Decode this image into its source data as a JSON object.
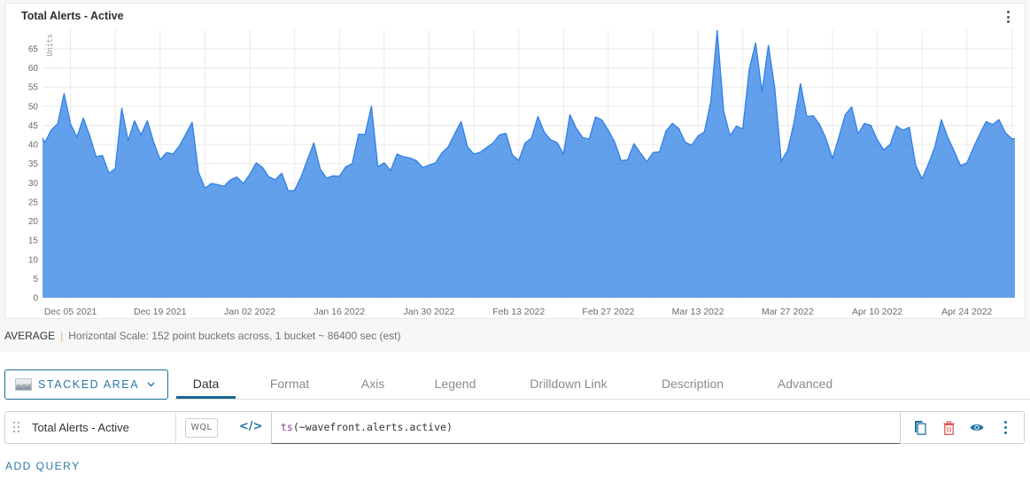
{
  "panel": {
    "title": "Total Alerts - Active",
    "menu_icon": "kebab-vertical-icon"
  },
  "chart_data": {
    "type": "area",
    "stacked": true,
    "title": "Total Alerts - Active",
    "xlabel": "",
    "ylabel": "Units",
    "ylim": [
      0,
      70
    ],
    "yticks": [
      0,
      5,
      10,
      15,
      20,
      25,
      30,
      35,
      40,
      45,
      50,
      55,
      60,
      65
    ],
    "x_start": "2021-12-01",
    "bucket": "1 day (86400 sec)",
    "xlim_days": [
      -0.37,
      151.5
    ],
    "x_grid_step_days": 7,
    "xticks": [
      {
        "date": "2021-12-05",
        "label": "Dec 05 2021"
      },
      {
        "date": "2021-12-19",
        "label": "Dec 19 2021"
      },
      {
        "date": "2022-01-02",
        "label": "Jan 02 2022"
      },
      {
        "date": "2022-01-16",
        "label": "Jan 16 2022"
      },
      {
        "date": "2022-01-30",
        "label": "Jan 30 2022"
      },
      {
        "date": "2022-02-13",
        "label": "Feb 13 2022"
      },
      {
        "date": "2022-02-27",
        "label": "Feb 27 2022"
      },
      {
        "date": "2022-03-13",
        "label": "Mar 13 2022"
      },
      {
        "date": "2022-03-27",
        "label": "Mar 27 2022"
      },
      {
        "date": "2022-04-10",
        "label": "Apr 10 2022"
      },
      {
        "date": "2022-04-24",
        "label": "Apr 24 2022"
      }
    ],
    "grid": true,
    "legend": "none",
    "series": [
      {
        "name": "Total Alerts - Active",
        "color": "#2f80e6",
        "left_edge_value": 41.7,
        "values": [
          40.5,
          43.8,
          45.4,
          53.3,
          45.4,
          41.9,
          46.9,
          42.3,
          36.8,
          37.1,
          32.5,
          33.7,
          49.5,
          41.0,
          46.2,
          42.5,
          46.2,
          40.6,
          36.0,
          37.9,
          37.5,
          39.6,
          42.7,
          45.8,
          32.7,
          28.6,
          29.8,
          29.5,
          29.1,
          30.8,
          31.5,
          29.8,
          32.2,
          35.2,
          34.0,
          31.5,
          30.8,
          32.5,
          27.9,
          28.0,
          31.5,
          36.0,
          40.4,
          33.6,
          31.2,
          31.8,
          31.7,
          34.2,
          35.0,
          42.7,
          42.6,
          50.0,
          34.2,
          35.2,
          33.2,
          37.5,
          36.8,
          36.5,
          35.8,
          34.0,
          34.6,
          35.2,
          37.8,
          39.4,
          42.8,
          46.0,
          39.4,
          37.5,
          38.0,
          39.2,
          40.4,
          42.5,
          42.9,
          37.3,
          35.8,
          40.4,
          41.7,
          47.3,
          43.2,
          41.2,
          40.5,
          37.5,
          47.8,
          44.2,
          41.8,
          41.4,
          47.2,
          46.4,
          43.7,
          40.6,
          35.8,
          36.0,
          40.2,
          37.8,
          35.5,
          37.9,
          38.1,
          43.5,
          45.5,
          44.2,
          40.6,
          39.8,
          42.2,
          43.3,
          51.2,
          69.8,
          48.8,
          42.3,
          44.8,
          44.1,
          59.6,
          66.5,
          53.8,
          65.9,
          54.6,
          35.6,
          38.5,
          45.8,
          55.9,
          47.3,
          47.5,
          45.2,
          41.5,
          36.3,
          41.9,
          47.8,
          49.8,
          42.8,
          45.5,
          45.0,
          41.2,
          38.6,
          40.0,
          44.8,
          43.7,
          44.5,
          34.6,
          31.0,
          35.0,
          39.4,
          46.5,
          41.9,
          38.3,
          34.5,
          35.2,
          39.1,
          42.7,
          46.0,
          45.2,
          46.5,
          43.1,
          41.5
        ]
      }
    ]
  },
  "summary": {
    "aggregation": "AVERAGE",
    "separator": "|",
    "scale_text": "Horizontal Scale: 152 point buckets across, 1 bucket ~ 86400 sec (est)"
  },
  "chart_type": {
    "label": "STACKED AREA",
    "icon": "stacked-area-chart-icon",
    "dropdown_icon": "chevron-down-icon"
  },
  "tabs": [
    {
      "label": "Data",
      "active": true
    },
    {
      "label": "Format",
      "active": false
    },
    {
      "label": "Axis",
      "active": false
    },
    {
      "label": "Legend",
      "active": false
    },
    {
      "label": "Drilldown Link",
      "active": false
    },
    {
      "label": "Description",
      "active": false
    },
    {
      "label": "Advanced",
      "active": false
    }
  ],
  "query": {
    "name": "Total Alerts - Active",
    "mode_label": "WQL",
    "editor_toggle_label": "</>",
    "expression": {
      "function": "ts",
      "args": "(~wavefront.alerts.active)"
    },
    "actions": [
      {
        "name": "copy",
        "icon": "copy-icon"
      },
      {
        "name": "delete",
        "icon": "trash-icon"
      },
      {
        "name": "toggle-visibility",
        "icon": "eye-icon"
      },
      {
        "name": "more",
        "icon": "kebab-vertical-icon"
      }
    ]
  },
  "add_query_label": "ADD QUERY",
  "colors": {
    "accent": "#1f73a3",
    "delete": "#e05757",
    "query_function": "#8b3a92",
    "series_fill": "#2f80e6",
    "separator": "#e3b27a"
  }
}
